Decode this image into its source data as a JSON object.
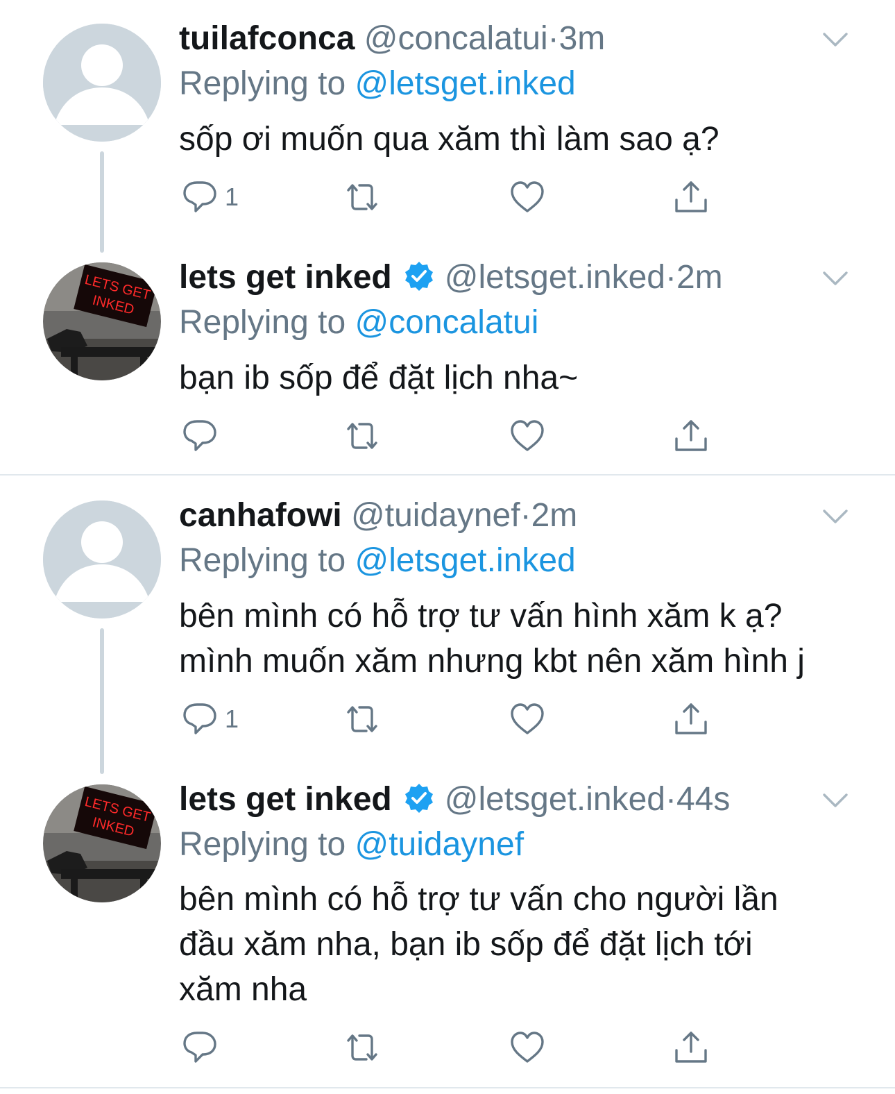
{
  "tweets": [
    {
      "name": "tuilafconca",
      "handle": "@concalatui",
      "dot": "·",
      "time": "3m",
      "verified": false,
      "reply_prefix": "Replying to",
      "reply_to": "@letsget.inked",
      "text": "sốp ơi muốn qua xăm thì làm sao ạ?",
      "reply_count": "1",
      "avatar": "default-avatar"
    },
    {
      "name": "lets get inked",
      "handle": "@letsget.inked",
      "dot": "·",
      "time": "2m",
      "verified": true,
      "reply_prefix": "Replying to",
      "reply_to": "@concalatui",
      "text": "bạn ib sốp để đặt lịch nha~",
      "reply_count": "",
      "avatar": "neon-sign-avatar",
      "avatar_sign_text": "LETS GET INKED"
    },
    {
      "name": "canhafowi",
      "handle": "@tuidaynef",
      "dot": "·",
      "time": "2m",
      "verified": false,
      "reply_prefix": "Replying to",
      "reply_to": "@letsget.inked",
      "text": "bên mình có hỗ trợ tư vấn hình xăm k ạ? mình muốn xăm nhưng kbt nên xăm hình j",
      "reply_count": "1",
      "avatar": "default-avatar"
    },
    {
      "name": "lets get inked",
      "handle": "@letsget.inked",
      "dot": "·",
      "time": "44s",
      "verified": true,
      "reply_prefix": "Replying to",
      "reply_to": "@tuidaynef",
      "text": "bên mình có hỗ trợ tư vấn cho người lần đầu xăm nha, bạn ib sốp để đặt lịch tới xăm nha",
      "reply_count": "",
      "avatar": "neon-sign-avatar",
      "avatar_sign_text": "LETS GET INKED"
    }
  ],
  "icons": {
    "reply": "reply-icon",
    "retweet": "retweet-icon",
    "like": "like-icon",
    "share": "share-icon",
    "caret": "chevron-down-icon",
    "verified": "verified-badge-icon"
  },
  "colors": {
    "text": "#14171a",
    "secondary": "#657786",
    "link": "#1b95e0",
    "thread_line": "#ccd6dd",
    "divider": "#e1e8ed",
    "neon": "#ff2a2a"
  }
}
